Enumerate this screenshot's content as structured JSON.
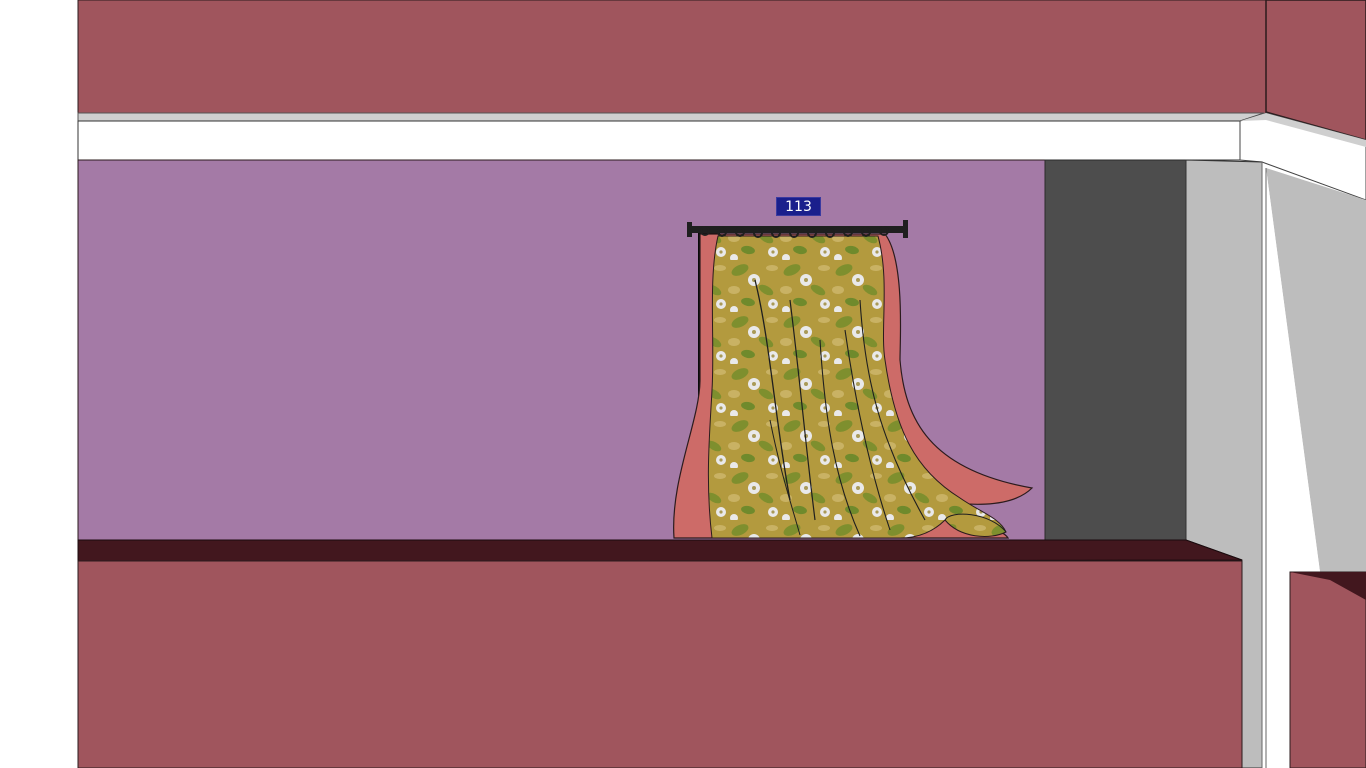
{
  "scene": {
    "room_label": "113",
    "colors": {
      "wall_upper": "#a0555d",
      "wall_lower": "#a0555d",
      "back_wall": "#a47aa6",
      "ceiling_trim": "#ffffff",
      "floor_ledge": "#42171e",
      "doorway": "#4d4d4d",
      "side_wall": "#bdbdbd",
      "label_bg": "#1a1f8c",
      "curtain_lining": "#cd6b68",
      "curtain_fabric": "#b39a3e",
      "curtain_leaf": "#7e8f2e",
      "curtain_flower": "#e9e9ea",
      "curtain_rod": "#1f1f1f"
    },
    "icons": {
      "curtain": "curtain-icon",
      "rod": "curtain-rod-icon"
    }
  }
}
